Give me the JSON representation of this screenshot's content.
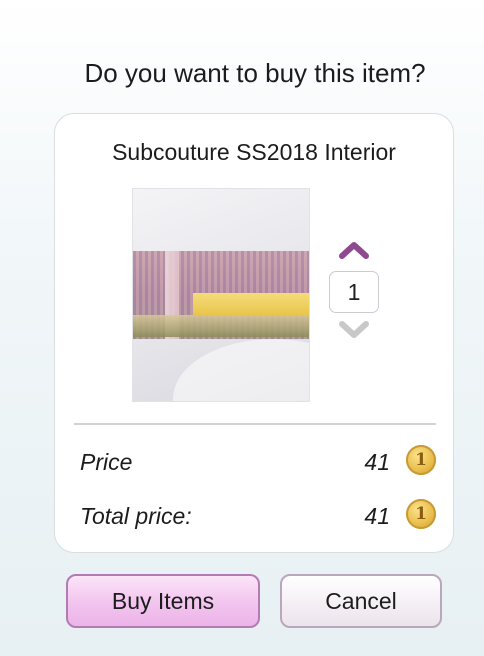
{
  "dialog": {
    "title": "Do you want to buy this item?",
    "item_name": "Subcouture SS2018 Interior",
    "quantity": "1",
    "price_label": "Price",
    "price_value": "41",
    "total_label": "Total price:",
    "total_value": "41",
    "coin_symbol": "1",
    "buy_label": "Buy Items",
    "cancel_label": "Cancel"
  },
  "icons": {
    "increase": "chevron-up-icon",
    "decrease": "chevron-down-icon",
    "currency": "coin-icon"
  },
  "colors": {
    "accent": "#8e4a8f",
    "disabled_arrow": "#c8c8c8",
    "buy_button": "#f2c4ee",
    "coin": "#e9be4c"
  }
}
